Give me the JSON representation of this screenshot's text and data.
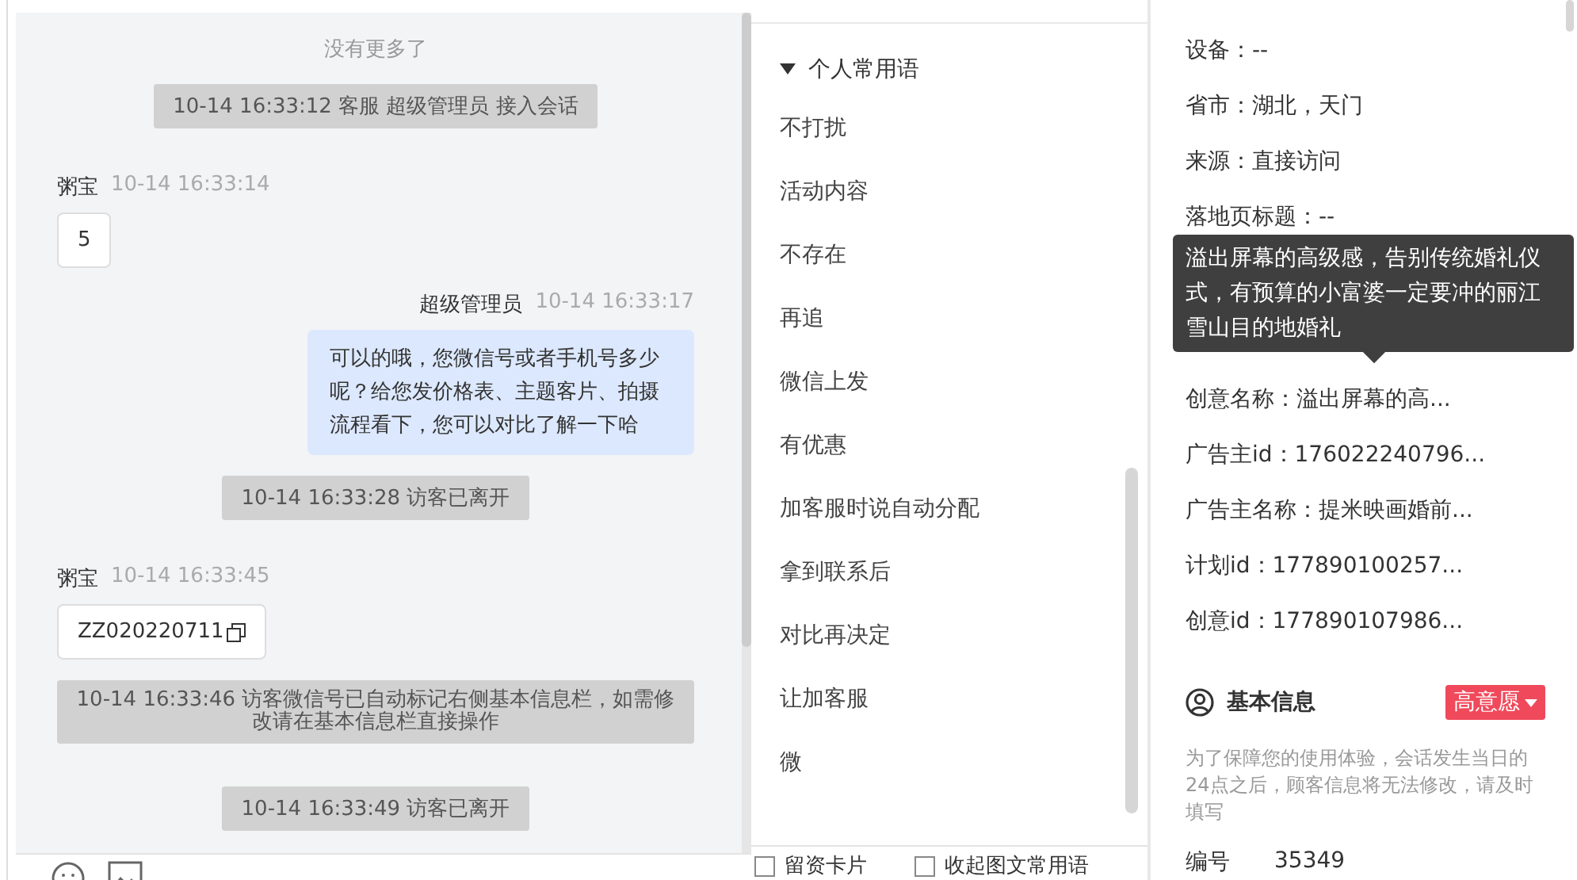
{
  "chat": {
    "end_notice": "没有更多了",
    "messages": [
      {
        "kind": "system",
        "text": "10-14 16:33:12 客服 超级管理员 接入会话"
      },
      {
        "kind": "visitor",
        "sender": "粥宝",
        "time": "10-14 16:33:14",
        "text": "5",
        "copyable": false
      },
      {
        "kind": "agent",
        "sender": "超级管理员",
        "time": "10-14 16:33:17",
        "text": "可以的哦，您微信号或者手机号多少呢？给您发价格表、主题客片、拍摄流程看下，您可以对比了解一下哈"
      },
      {
        "kind": "system",
        "text": "10-14 16:33:28 访客已离开"
      },
      {
        "kind": "visitor",
        "sender": "粥宝",
        "time": "10-14 16:33:45",
        "text": "ZZ020220711",
        "copyable": true
      },
      {
        "kind": "notice",
        "text": "10-14 16:33:46 访客微信号已自动标记右侧基本信息栏，如需修改请在基本信息栏直接操作"
      },
      {
        "kind": "system",
        "text": "10-14 16:33:49 访客已离开"
      }
    ]
  },
  "phrases": {
    "group": {
      "label": "个人常用语",
      "expanded": true
    },
    "items": [
      "不打扰",
      "活动内容",
      "不存在",
      "再追",
      "微信上发",
      "有优惠",
      "加客服时说自动分配",
      "拿到联系后",
      "对比再决定",
      "让加客服",
      "微"
    ],
    "options": [
      {
        "label": "留资卡片",
        "checked": false
      },
      {
        "label": "收起图文常用语",
        "checked": false
      }
    ]
  },
  "info": {
    "rows": [
      {
        "kind": "field",
        "text": "设备：--"
      },
      {
        "kind": "field",
        "text": "省市：湖北，天门"
      },
      {
        "kind": "field",
        "text": "来源：直接访问"
      },
      {
        "kind": "field",
        "text": "落地页标题：--"
      },
      {
        "kind": "tooltip",
        "text": "溢出屏幕的高级感，告别传统婚礼仪式，有预算的小富婆一定要冲的丽江雪山目的地婚礼"
      },
      {
        "kind": "field",
        "text": "创意名称：溢出屏幕的高..."
      },
      {
        "kind": "field",
        "text": "广告主id：176022240796..."
      },
      {
        "kind": "field",
        "text": "广告主名称：提米映画婚前..."
      },
      {
        "kind": "field",
        "text": "计划id：177890100257..."
      },
      {
        "kind": "field",
        "text": "创意id：177890107986..."
      }
    ],
    "section": {
      "title": "基本信息",
      "tag": "高意愿",
      "notice": "为了保障您的使用体验，会话发生当日的24点之后，顾客信息将无法修改，请及时填写",
      "number_label": "编号",
      "number": "35349"
    }
  }
}
